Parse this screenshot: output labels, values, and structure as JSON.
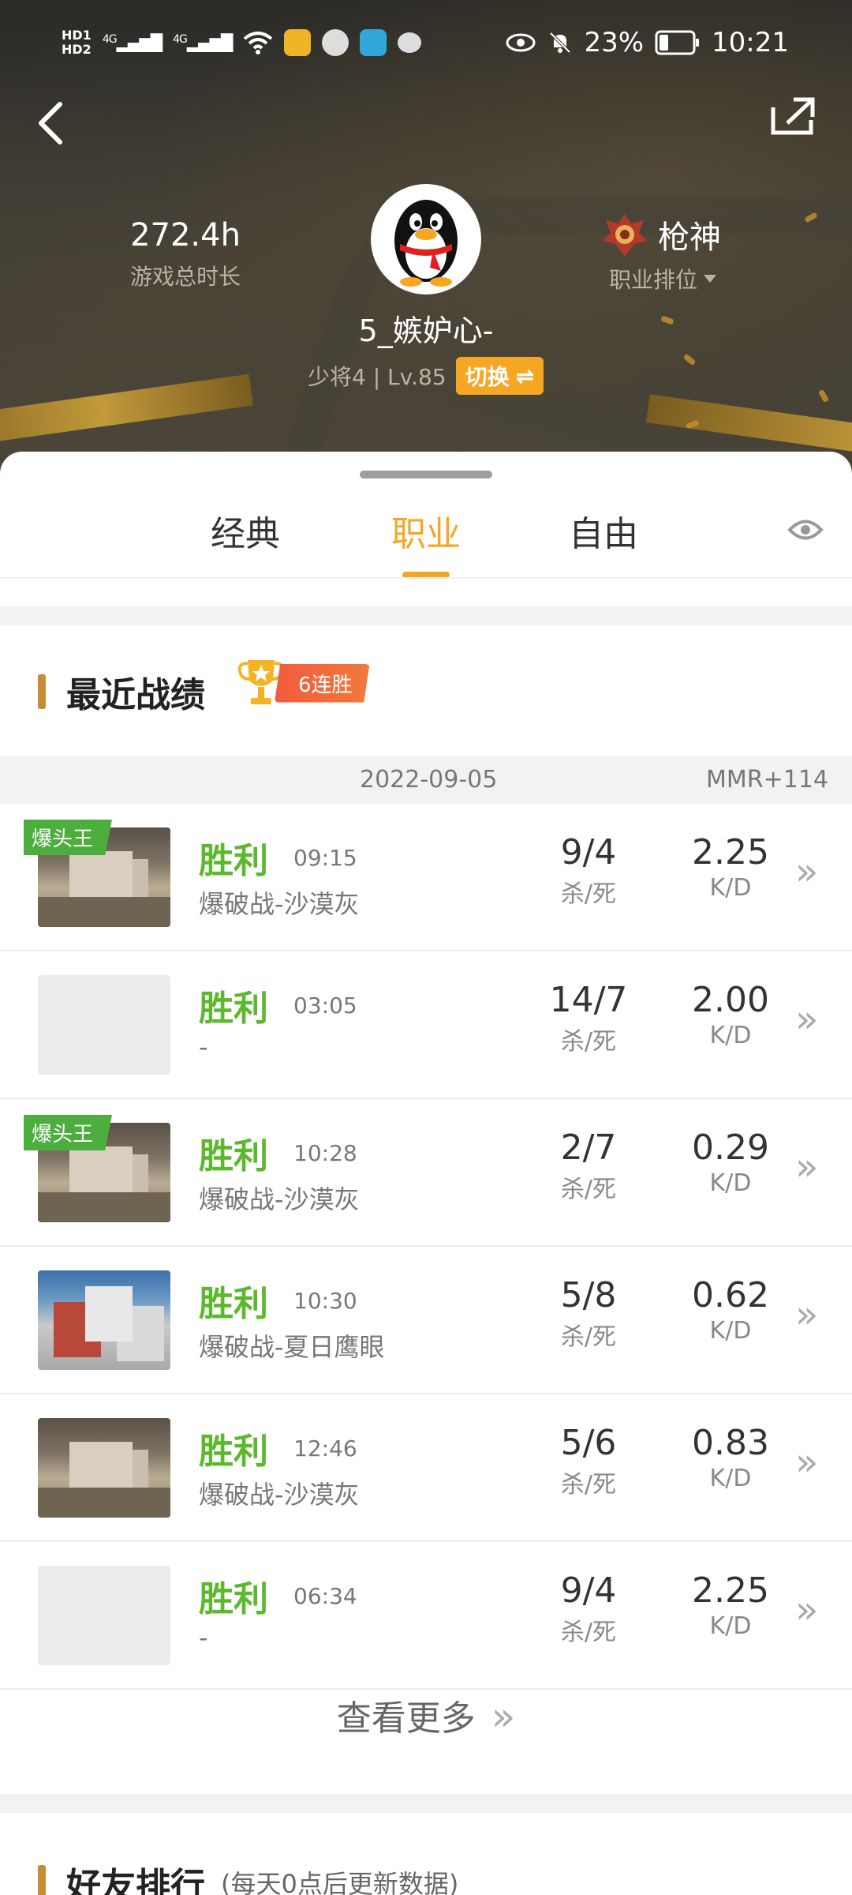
{
  "status_bar": {
    "hd1": "HD1",
    "hd2": "HD2",
    "network1": "4G",
    "network2": "4G",
    "battery": "23%",
    "time": "10:21"
  },
  "profile": {
    "play_time": "272.4h",
    "play_time_label": "游戏总时长",
    "username": "5_嫉妒心-",
    "rank_level": "少将4 | Lv.85",
    "switch_label": "切换",
    "career_rank": "枪神",
    "career_rank_label": "职业排位"
  },
  "tabs": [
    {
      "label": "经典",
      "active": false
    },
    {
      "label": "职业",
      "active": true
    },
    {
      "label": "自由",
      "active": false
    }
  ],
  "recent": {
    "title": "最近战绩",
    "streak": "6连胜",
    "date": "2022-09-05",
    "mmr": "MMR+114",
    "kd_unit": "杀/死",
    "kd_ratio_label": "K/D",
    "matches": [
      {
        "badge": "爆头王",
        "result": "胜利",
        "time": "09:15",
        "mode": "爆破战-沙漠灰",
        "kd": "9/4",
        "ratio": "2.25"
      },
      {
        "badge": "",
        "result": "胜利",
        "time": "03:05",
        "mode": "-",
        "kd": "14/7",
        "ratio": "2.00"
      },
      {
        "badge": "爆头王",
        "result": "胜利",
        "time": "10:28",
        "mode": "爆破战-沙漠灰",
        "kd": "2/7",
        "ratio": "0.29"
      },
      {
        "badge": "",
        "result": "胜利",
        "time": "10:30",
        "mode": "爆破战-夏日鹰眼",
        "kd": "5/8",
        "ratio": "0.62"
      },
      {
        "badge": "",
        "result": "胜利",
        "time": "12:46",
        "mode": "爆破战-沙漠灰",
        "kd": "5/6",
        "ratio": "0.83"
      },
      {
        "badge": "",
        "result": "胜利",
        "time": "06:34",
        "mode": "-",
        "kd": "9/4",
        "ratio": "2.25"
      }
    ],
    "more_label": "查看更多"
  },
  "friends": {
    "title": "好友排行",
    "subtitle": "(每天0点后更新数据)"
  },
  "colors": {
    "accent": "#f5a623",
    "win": "#5cb82c",
    "streak": "#f25b3e",
    "badge_green": "#4cae3c"
  }
}
